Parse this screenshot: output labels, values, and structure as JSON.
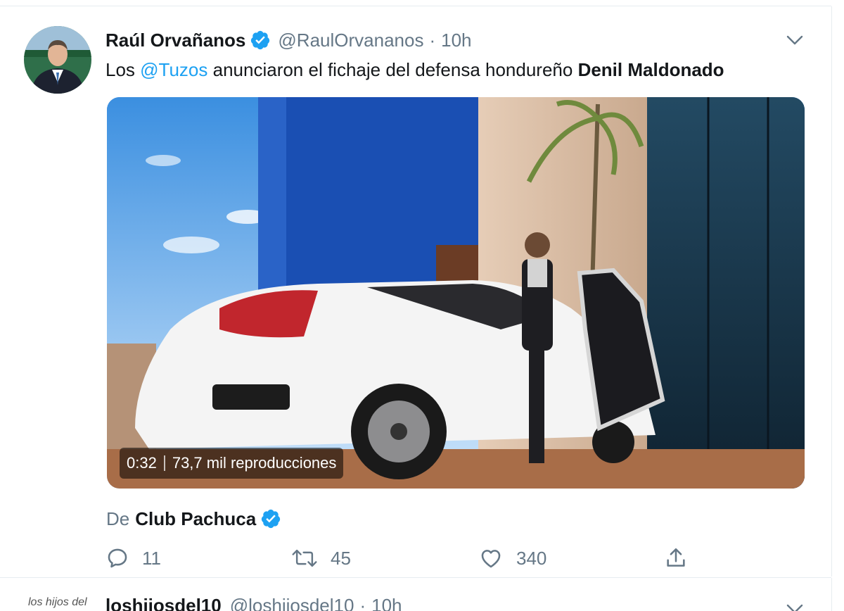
{
  "tweet": {
    "display_name": "Raúl Orvañanos",
    "handle": "@RaulOrvananos",
    "separator": "·",
    "time": "10h",
    "text": {
      "prefix": "Los ",
      "mention": "@Tuzos",
      "middle": " anunciaron el fichaje del defensa hondureño ",
      "bold": "Denil Maldonado"
    },
    "video": {
      "duration": "0:32",
      "views": "73,7 mil reproducciones"
    },
    "from": {
      "prefix": "De",
      "name": "Club Pachuca"
    },
    "actions": {
      "reply_count": "11",
      "retweet_count": "45",
      "like_count": "340"
    }
  },
  "next_tweet": {
    "avatar_text": "los hijos del",
    "display_name": "loshijosdel10",
    "handle": "@loshijosdel10",
    "separator": "·",
    "time": "10h"
  },
  "icons": {
    "verified": "verified-badge-icon",
    "caret": "chevron-down-icon",
    "reply": "reply-icon",
    "retweet": "retweet-icon",
    "like": "heart-icon",
    "share": "share-icon"
  },
  "colors": {
    "accent": "#1da1f2",
    "text": "#14171a",
    "secondary_text": "#657786",
    "border": "#e6ecf0"
  }
}
